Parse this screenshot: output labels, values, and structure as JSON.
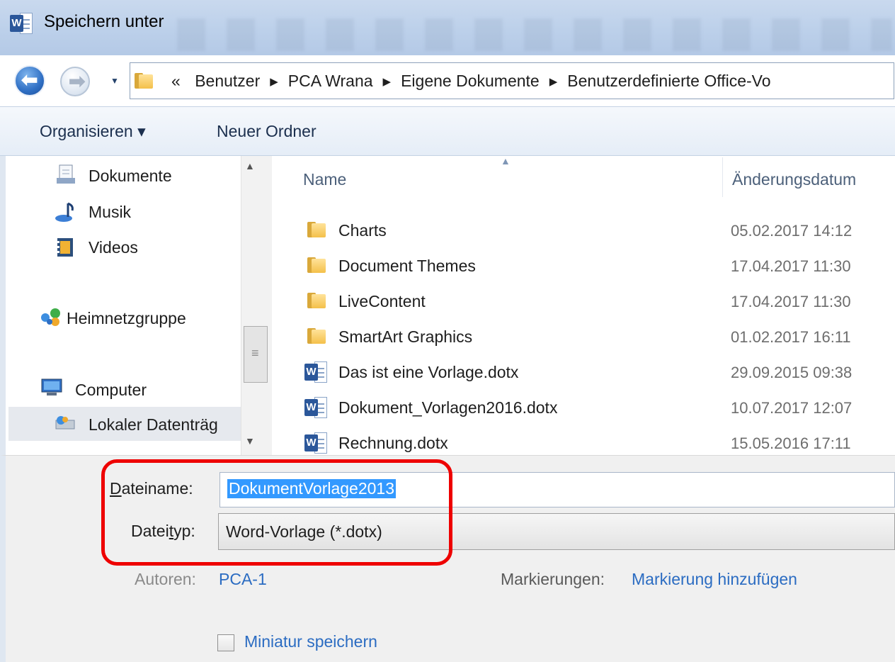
{
  "window": {
    "title": "Speichern unter",
    "icon": "word-icon"
  },
  "address": {
    "prefix": "«",
    "crumbs": [
      "Benutzer",
      "PCA Wrana",
      "Eigene Dokumente",
      "Benutzerdefinierte Office-Vo"
    ]
  },
  "toolbar": {
    "organize_label": "Organisieren ▾",
    "new_folder_label": "Neuer Ordner"
  },
  "nav": {
    "items": [
      {
        "label": "Dokumente",
        "icon": "documents-icon"
      },
      {
        "label": "Musik",
        "icon": "music-icon"
      },
      {
        "label": "Videos",
        "icon": "videos-icon"
      },
      {
        "label": "Heimnetzgruppe",
        "icon": "homegroup-icon"
      },
      {
        "label": "Computer",
        "icon": "computer-icon"
      },
      {
        "label": "Lokaler Datenträg",
        "icon": "local-disk-icon"
      }
    ]
  },
  "list": {
    "columns": {
      "name": "Name",
      "date": "Änderungsdatum"
    },
    "rows": [
      {
        "name": "Charts",
        "date": "05.02.2017 14:12",
        "type": "folder"
      },
      {
        "name": "Document Themes",
        "date": "17.04.2017 11:30",
        "type": "folder"
      },
      {
        "name": "LiveContent",
        "date": "17.04.2017 11:30",
        "type": "folder"
      },
      {
        "name": "SmartArt Graphics",
        "date": "01.02.2017 16:11",
        "type": "folder"
      },
      {
        "name": "Das ist eine Vorlage.dotx",
        "date": "29.09.2015 09:38",
        "type": "word"
      },
      {
        "name": "Dokument_Vorlagen2016.dotx",
        "date": "10.07.2017 12:07",
        "type": "word"
      },
      {
        "name": "Rechnung.dotx",
        "date": "15.05.2016 17:11",
        "type": "word"
      }
    ]
  },
  "form": {
    "filename_label_u": "D",
    "filename_label_rest": "ateiname:",
    "filename_value": "DokumentVorlage2013",
    "filetype_label_a": "Datei",
    "filetype_label_u": "t",
    "filetype_label_b": "yp:",
    "filetype_value": "Word-Vorlage (*.dotx)",
    "authors_label": "Autoren:",
    "authors_value": "PCA-1",
    "tags_label": "Markierungen:",
    "tags_value": "Markierung hinzufügen",
    "thumbnail_label": "Miniatur speichern"
  },
  "colors": {
    "highlight": "#ee0000",
    "selection": "#3399ff",
    "link": "#2b6cc2"
  }
}
